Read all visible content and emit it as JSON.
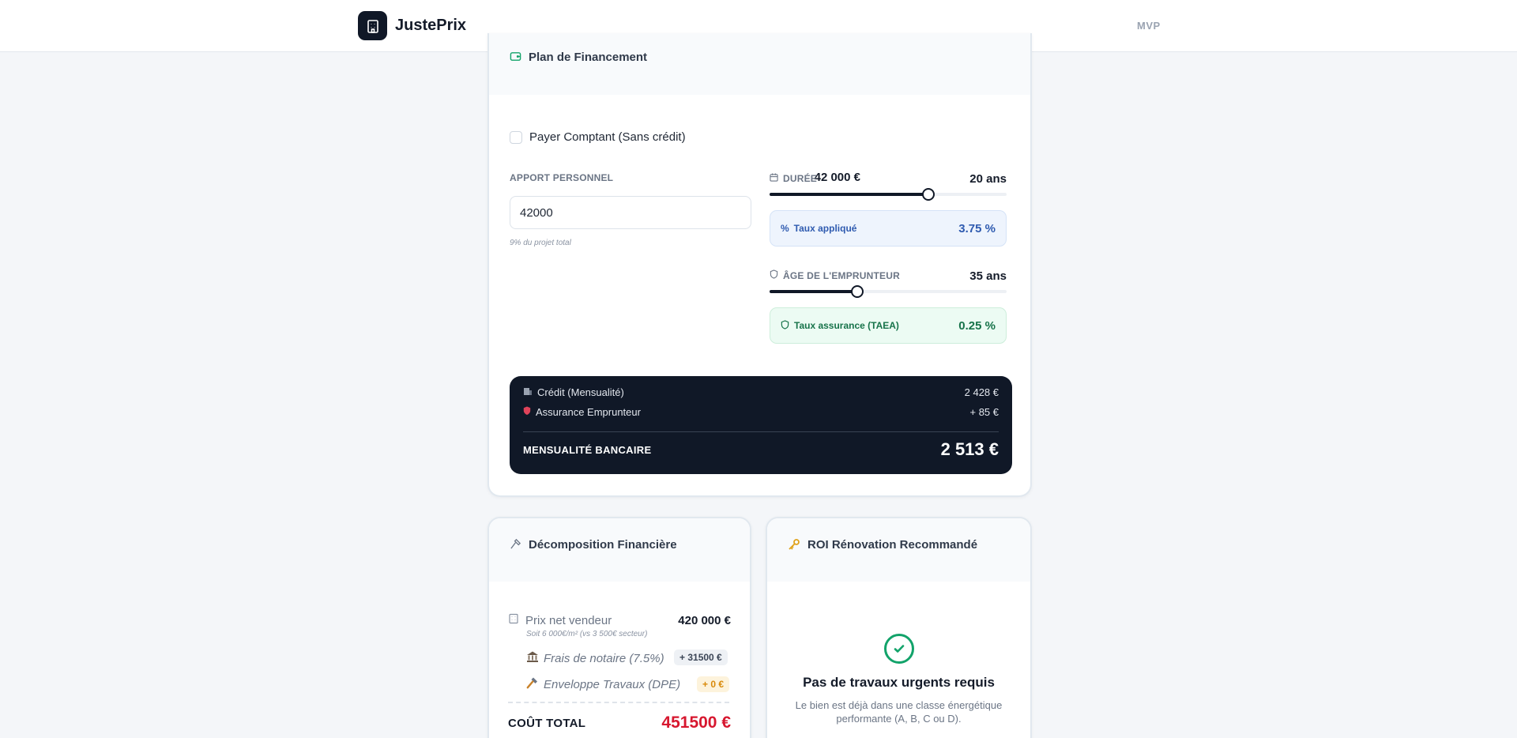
{
  "app": {
    "name": "JustePrix",
    "badge": "MVP"
  },
  "plan": {
    "title": "Plan de Financement",
    "cash_label": "Payer Comptant (Sans crédit)",
    "cash_checked": false,
    "apport_label": "APPORT PERSONNEL",
    "apport_value": "42 000 €",
    "apport_input": "42000",
    "apport_hint": "9% du projet total",
    "duree_label": "DURÉE",
    "duree_value": "20 ans",
    "duree_fraction": 0.67,
    "taux_label": "Taux appliqué",
    "taux_value": "3.75 %",
    "age_label": "ÂGE DE L'EMPRUNTEUR",
    "age_value": "35 ans",
    "age_fraction": 0.37,
    "assurance_label": "Taux assurance (TAEA)",
    "assurance_value": "0.25 %"
  },
  "summary": {
    "credit_label": "Crédit (Mensualité)",
    "credit_value": "2 428 €",
    "assurance_label": "Assurance Emprunteur",
    "assurance_value": "+ 85 €",
    "total_label": "MENSUALITÉ BANCAIRE",
    "total_value": "2 513 €"
  },
  "decomposition": {
    "title": "Décomposition Financière",
    "prix_label": "Prix net vendeur",
    "prix_value": "420 000 €",
    "prix_sub": "Soit 6 000€/m² (vs 3 500€ secteur)",
    "notaire_label": "Frais de notaire (7.5%)",
    "notaire_value": "+ 31500 €",
    "travaux_label": "Enveloppe Travaux (DPE)",
    "travaux_value": "+ 0 €",
    "total_label": "COÛT TOTAL",
    "total_value": "451500 €"
  },
  "roi": {
    "title": "ROI Rénovation Recommandé",
    "heading": "Pas de travaux urgents requis",
    "desc": "Le bien est déjà dans une classe énergétique performante (A, B, C ou D)."
  },
  "colors": {
    "accent": "#101827",
    "blue": "#2f5bb0",
    "green": "#17734a",
    "red": "#d7172f"
  }
}
